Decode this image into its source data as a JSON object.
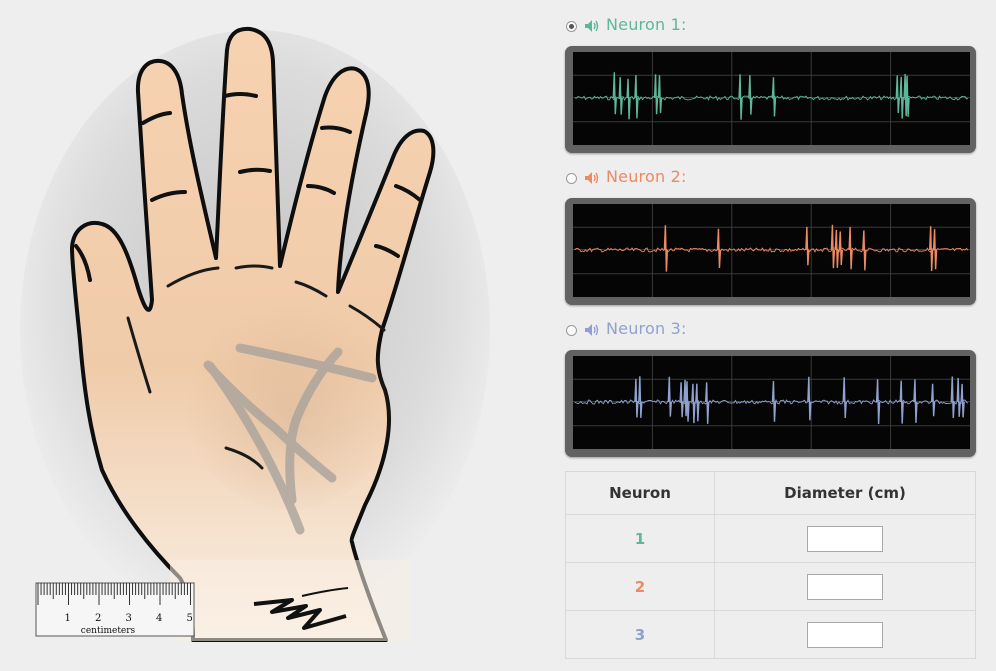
{
  "ruler": {
    "ticks": [
      "1",
      "2",
      "3",
      "4",
      "5"
    ],
    "unit_label": "centimeters"
  },
  "neurons": [
    {
      "id": "1",
      "label": "Neuron 1:",
      "color": "#5db79a",
      "selected": true,
      "spike_times": [
        0.1,
        0.115,
        0.135,
        0.155,
        0.205,
        0.215,
        0.42,
        0.445,
        0.505,
        0.82,
        0.83,
        0.84,
        0.845
      ]
    },
    {
      "id": "2",
      "label": "Neuron 2:",
      "color": "#ec8a63",
      "selected": false,
      "spike_times": [
        0.23,
        0.365,
        0.59,
        0.655,
        0.665,
        0.675,
        0.7,
        0.735,
        0.905,
        0.915
      ]
    },
    {
      "id": "3",
      "label": "Neuron 3:",
      "color": "#8fa2cf",
      "selected": false,
      "spike_times": [
        0.155,
        0.165,
        0.24,
        0.27,
        0.28,
        0.285,
        0.3,
        0.31,
        0.335,
        0.505,
        0.595,
        0.685,
        0.77,
        0.83,
        0.865,
        0.91,
        0.96,
        0.975,
        0.985
      ]
    }
  ],
  "table": {
    "col_neuron": "Neuron",
    "col_diameter": "Diameter (cm)",
    "rows": [
      {
        "num": "1",
        "value": "",
        "color": "#5db79a"
      },
      {
        "num": "2",
        "value": "",
        "color": "#ec8a63"
      },
      {
        "num": "3",
        "value": "",
        "color": "#8fa2cf"
      }
    ]
  }
}
